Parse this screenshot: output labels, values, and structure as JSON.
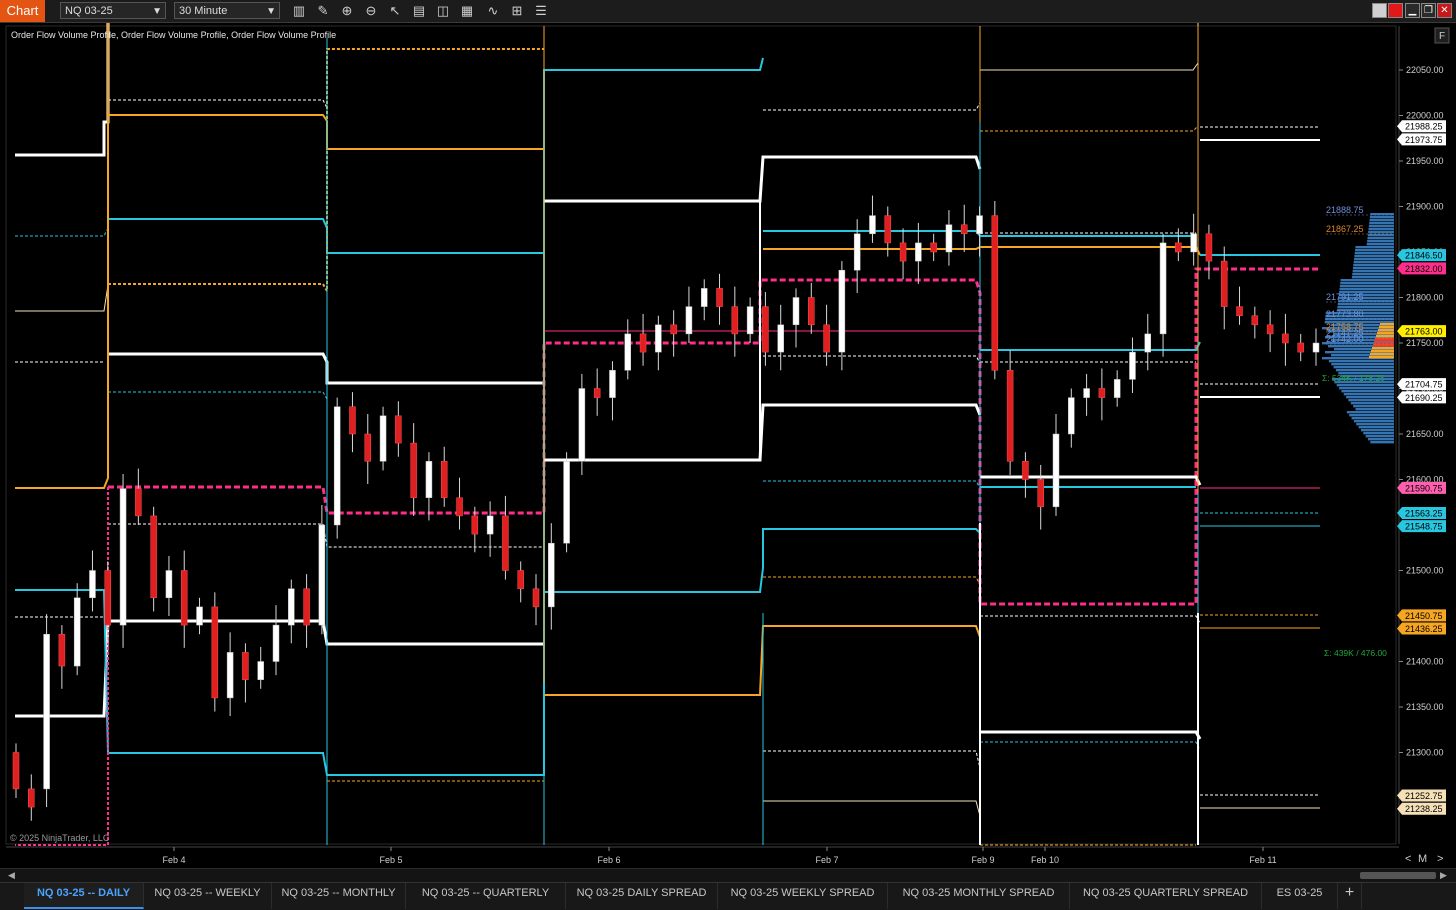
{
  "app": {
    "title": "Chart"
  },
  "toolbar": {
    "instrument": "NQ 03-25",
    "interval": "30 Minute",
    "icons": [
      "bar-type-icon",
      "pencil-draw-icon",
      "zoom-in-icon",
      "zoom-out-icon",
      "pointer-icon",
      "data-box-icon",
      "templates-icon",
      "properties-icon",
      "strategies-icon",
      "indicators-list-icon"
    ]
  },
  "chart": {
    "indicator_label": "Order Flow Volume Profile, Order Flow Volume Profile, Order Flow Volume Profile",
    "copyright": "© 2025 NinjaTrader, LLC",
    "panel_button": "F",
    "date_labels": [
      "Feb 4",
      "Feb 5",
      "Feb 6",
      "Feb 7",
      "Feb 9",
      "Feb 10",
      "Feb 11"
    ],
    "price_ticks": [
      "22050.00",
      "22000.00",
      "21950.00",
      "21900.00",
      "21850.00",
      "21800.00",
      "21750.00",
      "21700.00",
      "21650.00",
      "21600.00",
      "21550.00",
      "21500.00",
      "21450.00",
      "21400.00",
      "21350.00",
      "21300.00",
      "21250.00"
    ],
    "price_markers": [
      {
        "value": "21988.25",
        "bg": "#ffffff",
        "fg": "#000000"
      },
      {
        "value": "21973.75",
        "bg": "#ffffff",
        "fg": "#000000"
      },
      {
        "value": "21846.50",
        "bg": "#29c6e0",
        "fg": "#000000"
      },
      {
        "value": "21832.00",
        "bg": "#ff2e8a",
        "fg": "#000000"
      },
      {
        "value": "21763.00",
        "bg": "#ffee00",
        "fg": "#000000"
      },
      {
        "value": "21704.75",
        "bg": "#ffffff",
        "fg": "#000000"
      },
      {
        "value": "21690.25",
        "bg": "#ffffff",
        "fg": "#000000"
      },
      {
        "value": "21590.75",
        "bg": "#ff5fae",
        "fg": "#000000"
      },
      {
        "value": "21563.25",
        "bg": "#29c6e0",
        "fg": "#000000"
      },
      {
        "value": "21548.75",
        "bg": "#29c6e0",
        "fg": "#000000"
      },
      {
        "value": "21450.75",
        "bg": "#f6a623",
        "fg": "#000000"
      },
      {
        "value": "21436.25",
        "bg": "#f6a623",
        "fg": "#000000"
      },
      {
        "value": "21252.75",
        "bg": "#f5e0b8",
        "fg": "#000000"
      },
      {
        "value": "21238.25",
        "bg": "#f5e0b8",
        "fg": "#000000"
      }
    ],
    "profile_labels": [
      {
        "value": "21888.75",
        "color": "#6f8fd8"
      },
      {
        "value": "21867.25",
        "color": "#d8862a"
      },
      {
        "value": "21791.25",
        "color": "#6f8fd8"
      },
      {
        "value": "21773.80",
        "color": "#6f8fd8"
      },
      {
        "value": "21758.75",
        "color": "#d8862a"
      },
      {
        "value": "21747.25",
        "color": "#6f8fd8"
      },
      {
        "value": "21742.00",
        "color": "#6f8fd8"
      }
    ],
    "volume_labels": [
      {
        "value": "Σ: 534K / 178.25",
        "color": "#1fa83a"
      },
      {
        "value": "Σ: 439K / 476.00",
        "color": "#1fa83a"
      }
    ],
    "scale_buttons": [
      "<",
      "M",
      ">"
    ]
  },
  "tabs": [
    {
      "label": "NQ 03-25 -- DAILY",
      "active": true
    },
    {
      "label": "NQ 03-25 -- WEEKLY",
      "active": false
    },
    {
      "label": "NQ 03-25 -- MONTHLY",
      "active": false
    },
    {
      "label": "NQ 03-25 -- QUARTERLY",
      "active": false
    },
    {
      "label": "NQ 03-25 DAILY SPREAD",
      "active": false
    },
    {
      "label": "NQ 03-25 WEEKLY SPREAD",
      "active": false
    },
    {
      "label": "NQ 03-25 MONTHLY SPREAD",
      "active": false
    },
    {
      "label": "NQ 03-25 QUARTERLY SPREAD",
      "active": false
    },
    {
      "label": "ES 03-25",
      "active": false
    }
  ],
  "add_tab": "+",
  "colors": {
    "accent": "#e45514",
    "white": "#ffffff",
    "orange": "#f6a623",
    "cyan": "#29c6e0",
    "pink": "#ff2e8a",
    "cream": "#f5e0b8",
    "bull": "#ffffff",
    "bear": "#e02020"
  },
  "chart_data": {
    "type": "candlestick",
    "instrument": "NQ 03-25",
    "interval": "30 Minute",
    "ylim": [
      21220,
      22080
    ],
    "ohlc_approx": [
      [
        21300,
        21260
      ],
      [
        21260,
        21240
      ],
      [
        21260,
        21430
      ],
      [
        21430,
        21395
      ],
      [
        21395,
        21470
      ],
      [
        21470,
        21500
      ],
      [
        21500,
        21440
      ],
      [
        21440,
        21590
      ],
      [
        21590,
        21560
      ],
      [
        21560,
        21470
      ],
      [
        21470,
        21500
      ],
      [
        21500,
        21440
      ],
      [
        21440,
        21460
      ],
      [
        21460,
        21360
      ],
      [
        21360,
        21410
      ],
      [
        21410,
        21380
      ],
      [
        21380,
        21400
      ],
      [
        21400,
        21440
      ],
      [
        21440,
        21480
      ],
      [
        21480,
        21440
      ],
      [
        21440,
        21550
      ],
      [
        21550,
        21680
      ],
      [
        21680,
        21650
      ],
      [
        21650,
        21620
      ],
      [
        21620,
        21670
      ],
      [
        21670,
        21640
      ],
      [
        21640,
        21580
      ],
      [
        21580,
        21620
      ],
      [
        21620,
        21580
      ],
      [
        21580,
        21560
      ],
      [
        21560,
        21540
      ],
      [
        21540,
        21560
      ],
      [
        21560,
        21500
      ],
      [
        21500,
        21480
      ],
      [
        21480,
        21460
      ],
      [
        21460,
        21530
      ],
      [
        21530,
        21620
      ],
      [
        21620,
        21700
      ],
      [
        21700,
        21690
      ],
      [
        21690,
        21720
      ],
      [
        21720,
        21760
      ],
      [
        21760,
        21740
      ],
      [
        21740,
        21770
      ],
      [
        21770,
        21760
      ],
      [
        21760,
        21790
      ],
      [
        21790,
        21810
      ],
      [
        21810,
        21790
      ],
      [
        21790,
        21760
      ],
      [
        21760,
        21790
      ],
      [
        21790,
        21740
      ],
      [
        21740,
        21770
      ],
      [
        21770,
        21800
      ],
      [
        21800,
        21770
      ],
      [
        21770,
        21740
      ],
      [
        21740,
        21830
      ],
      [
        21830,
        21870
      ],
      [
        21870,
        21890
      ],
      [
        21890,
        21860
      ],
      [
        21860,
        21840
      ],
      [
        21840,
        21860
      ],
      [
        21860,
        21850
      ],
      [
        21850,
        21880
      ],
      [
        21880,
        21870
      ],
      [
        21870,
        21890
      ],
      [
        21890,
        21720
      ],
      [
        21720,
        21620
      ],
      [
        21620,
        21600
      ],
      [
        21600,
        21570
      ],
      [
        21570,
        21650
      ],
      [
        21650,
        21690
      ],
      [
        21690,
        21700
      ],
      [
        21700,
        21690
      ],
      [
        21690,
        21710
      ],
      [
        21710,
        21740
      ],
      [
        21740,
        21760
      ],
      [
        21760,
        21860
      ],
      [
        21860,
        21850
      ],
      [
        21850,
        21870
      ],
      [
        21870,
        21840
      ],
      [
        21840,
        21790
      ],
      [
        21790,
        21780
      ],
      [
        21780,
        21770
      ],
      [
        21770,
        21760
      ],
      [
        21760,
        21750
      ],
      [
        21750,
        21740
      ],
      [
        21740,
        21750
      ]
    ]
  }
}
